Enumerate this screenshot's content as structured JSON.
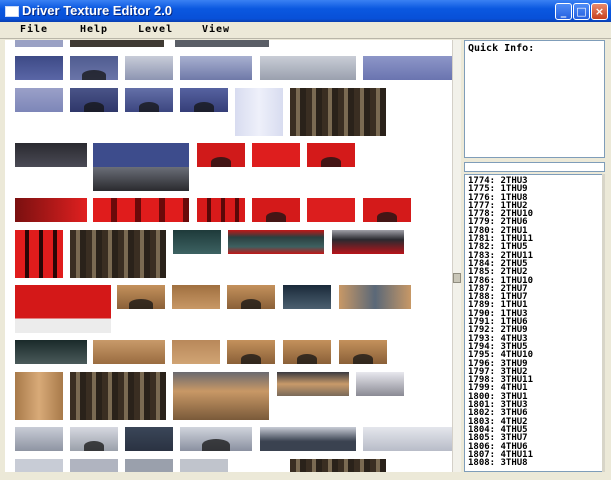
{
  "window": {
    "title": "Driver Texture Editor 2.0"
  },
  "menu": [
    {
      "label": "File"
    },
    {
      "label": "Help"
    },
    {
      "label": "Level"
    },
    {
      "label": "View"
    }
  ],
  "quick_info": {
    "label": "Quick Info:"
  },
  "texture_list": [
    "1774: 2THU3",
    "1775: 1THU9",
    "1776: 1THU8",
    "1777: 1THU2",
    "1778: 2THU10",
    "1779: 2THU6",
    "1780: 2THU1",
    "1781: 1THU11",
    "1782: 1THU5",
    "1783: 2THU11",
    "1784: 2THU5",
    "1785: 2THU2",
    "1786: 1THU10",
    "1787: 2THU7",
    "1788: 1THU7",
    "1789: 1THU1",
    "1790: 1THU3",
    "1791: 1THU6",
    "1792: 2THU9",
    "1793: 4THU3",
    "1794: 3THU5",
    "1795: 4THU10",
    "1796: 3THU9",
    "1797: 3THU2",
    "1798: 3THU11",
    "1799: 4THU1",
    "1800: 3THU1",
    "1801: 3THU3",
    "1802: 3THU6",
    "1803: 4THU2",
    "1804: 4THU5",
    "1805: 3THU7",
    "1806: 4THU6",
    "1807: 4THU11",
    "1808: 3THU8"
  ],
  "colors": {
    "titlebar": "#0a58e0",
    "panel_bg": "#ffffff",
    "window_bg": "#ece9d8"
  }
}
